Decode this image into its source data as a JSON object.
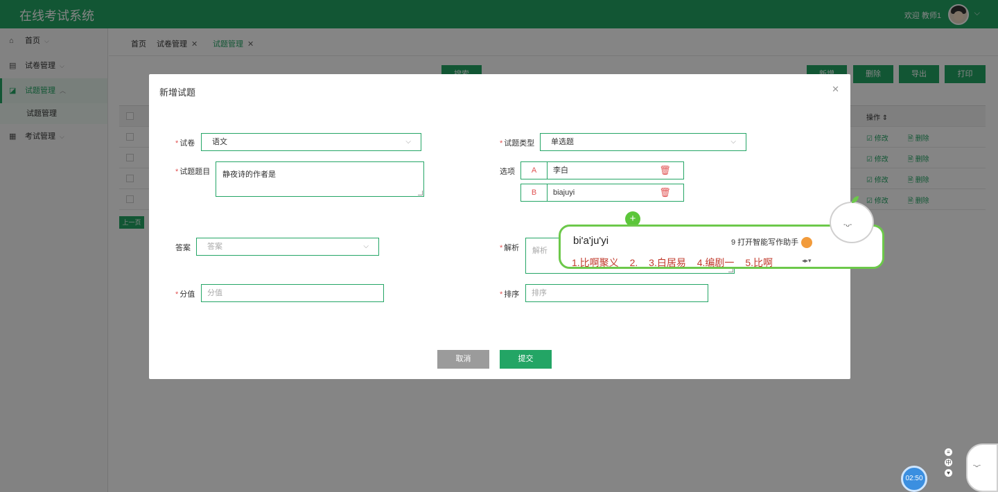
{
  "header": {
    "app_title": "在线考试系统",
    "welcome": "欢迎 教师1"
  },
  "sidebar": {
    "items": [
      {
        "label": "首页",
        "icon": "home-icon"
      },
      {
        "label": "试卷管理",
        "icon": "paper-icon"
      },
      {
        "label": "试题管理",
        "icon": "question-icon",
        "sub": "试题管理"
      },
      {
        "label": "考试管理",
        "icon": "grid-icon"
      }
    ]
  },
  "tabs": [
    {
      "label": "首页"
    },
    {
      "label": "试卷管理"
    },
    {
      "label": "试题管理"
    }
  ],
  "toolbar": {
    "add": "新增",
    "delete": "删除",
    "export": "导出",
    "print": "打印",
    "search": "搜索"
  },
  "table": {
    "ops_header": "操作",
    "edit": "修改",
    "remove": "删除",
    "prev": "上一页"
  },
  "modal": {
    "title": "新增试题",
    "paper_label": "试卷",
    "paper_value": "语文",
    "type_label": "试题类型",
    "type_value": "单选题",
    "question_label": "试题题目",
    "question_value": "静夜诗的作者是",
    "options_label": "选项",
    "options": [
      {
        "letter": "A",
        "value": "李白"
      },
      {
        "letter": "B",
        "value": "biajuyi"
      }
    ],
    "answer_label": "答案",
    "answer_placeholder": "答案",
    "analysis_label": "解析",
    "analysis_placeholder": "解析",
    "score_label": "分值",
    "score_placeholder": "分值",
    "order_label": "排序",
    "order_placeholder": "排序",
    "cancel": "取消",
    "submit": "提交"
  },
  "ime": {
    "pinyin": "bi'a'ju'yi",
    "assist": "9 打开智能写作助手",
    "candidates": [
      "1.比啊聚义",
      "2.",
      "3.白居易",
      "4.编剧一",
      "5.比啊"
    ]
  },
  "timer": "02:50",
  "colors": {
    "primary": "#23a565",
    "danger": "#e05252",
    "ime_border": "#6cc84a"
  }
}
